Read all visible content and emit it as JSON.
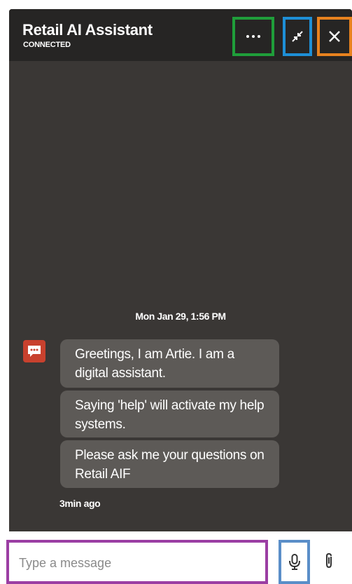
{
  "header": {
    "title": "Retail AI Assistant",
    "status": "CONNECTED"
  },
  "conversation": {
    "timestamp": "Mon Jan 29, 1:56 PM",
    "messages": [
      "Greetings, I am Artie. I am a digital assistant.",
      "Saying 'help' will activate my help systems.",
      "Please ask me your questions on Retail AIF"
    ],
    "time_ago": "3min ago"
  },
  "composer": {
    "placeholder": "Type a message",
    "value": ""
  },
  "icons": {
    "more": "ellipsis-icon",
    "minimize": "collapse-icon",
    "close": "close-icon",
    "avatar": "chat-bubble-icon",
    "mic": "microphone-icon",
    "attach": "paperclip-icon"
  },
  "colors": {
    "header_bg": "#262524",
    "body_bg": "#3a3735",
    "bubble_bg": "#5d5a57",
    "avatar_bg": "#c8412e",
    "more_outline": "#1f9e3a",
    "minimize_outline": "#1e8fd6",
    "close_outline": "#e8821e",
    "input_outline": "#9b3ea3",
    "mic_outline": "#5a8ec8"
  }
}
